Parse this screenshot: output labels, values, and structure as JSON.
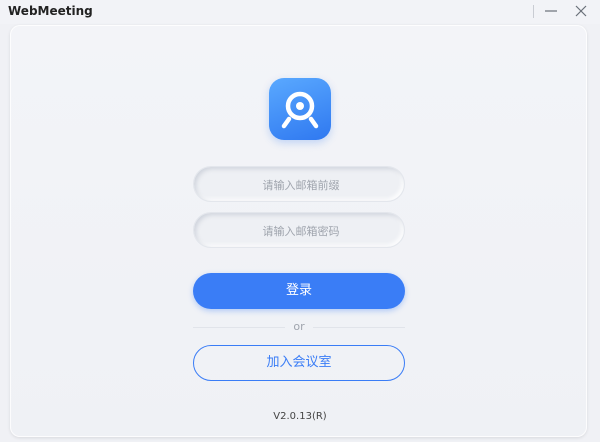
{
  "window": {
    "title": "WebMeeting",
    "minimize_icon": "minimize-icon",
    "close_icon": "close-icon"
  },
  "logo": {
    "icon": "webcam-icon",
    "colors": [
      "#5aa9ff",
      "#2f78f0"
    ]
  },
  "form": {
    "email_prefix_placeholder": "请输入邮箱前缀",
    "email_password_placeholder": "请输入邮箱密码",
    "login_label": "登录",
    "or_label": "or",
    "join_meeting_label": "加入会议室"
  },
  "footer": {
    "version": "V2.0.13(R)"
  },
  "colors": {
    "accent": "#3a7df6",
    "background": "#f0f1f5"
  }
}
